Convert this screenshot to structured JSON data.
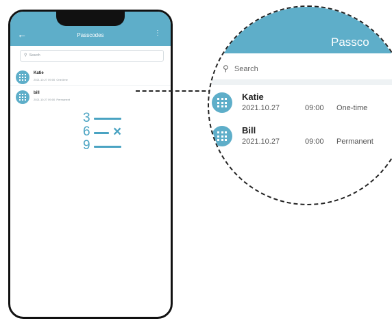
{
  "app": {
    "title": "Passcodes",
    "back_icon": "arrow-left-icon",
    "more_icon": "more-vertical-icon",
    "accent_color": "#5eaec9"
  },
  "search": {
    "placeholder": "Search",
    "icon": "search-icon"
  },
  "passcodes": [
    {
      "name": "Katie",
      "date": "2021.10.27",
      "time": "09:00",
      "type": "One-time"
    },
    {
      "name": "bill",
      "date": "2021.10.27",
      "time": "09:00",
      "type": "Permanent"
    }
  ],
  "zoom": {
    "title": "Passco",
    "search_placeholder": "Search",
    "rows": [
      {
        "name": "Katie",
        "date": "2021.10.27",
        "time": "09:00",
        "type": "One-time"
      },
      {
        "name": "Bill",
        "date": "2021.10.27",
        "time": "09:00",
        "type": "Permanent"
      }
    ]
  },
  "illustration": {
    "digits": [
      "3",
      "6",
      "9"
    ],
    "delete_mark": "×"
  }
}
